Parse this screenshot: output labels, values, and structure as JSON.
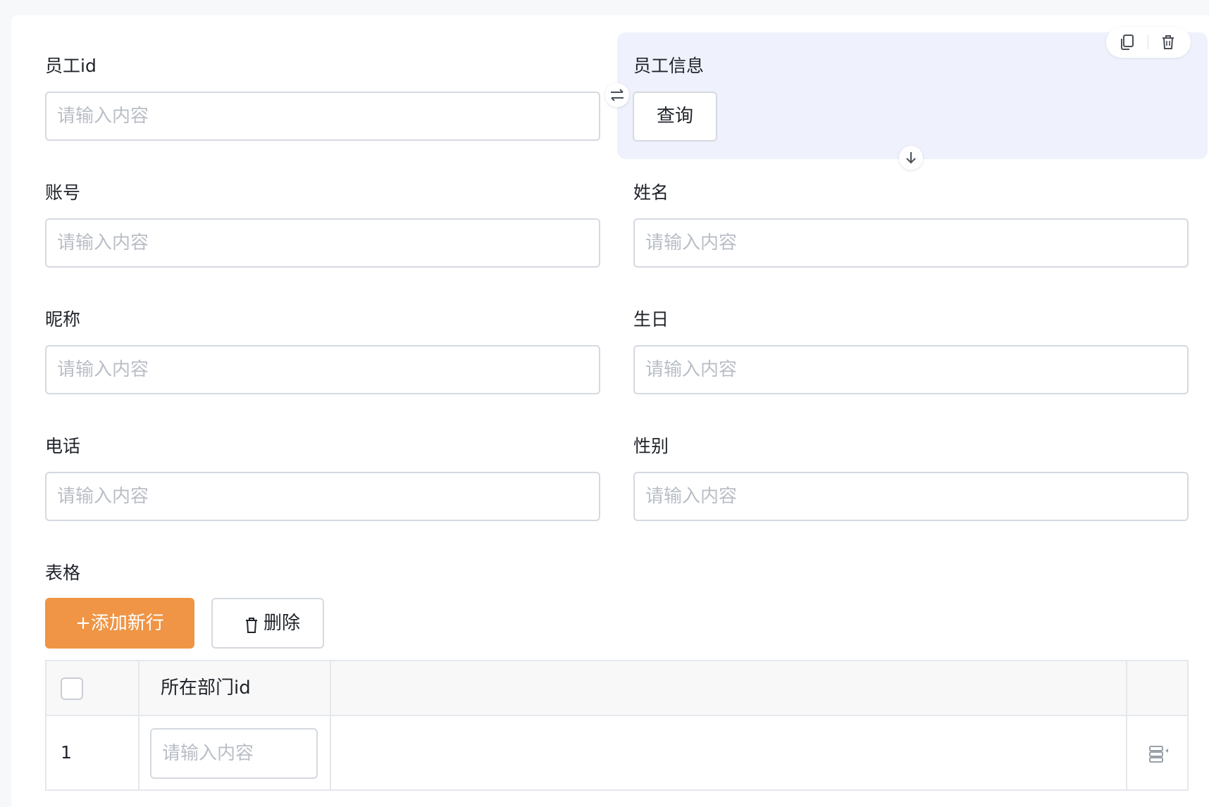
{
  "form": {
    "placeholder": "请输入内容",
    "fields": {
      "employee_id": "员工id",
      "account": "账号",
      "nickname": "昵称",
      "phone": "电话",
      "name": "姓名",
      "birthday": "生日",
      "gender": "性别"
    },
    "employee_info": {
      "label": "员工信息",
      "query_button": "查询"
    },
    "table_label": "表格"
  },
  "table": {
    "add_row_button": "+添加新行",
    "delete_button": "删除",
    "columns": [
      "所在部门id"
    ],
    "rows": [
      {
        "index": "1"
      }
    ]
  },
  "icons": {
    "copy": "copy-icon",
    "delete": "trash-icon",
    "swap": "swap-icon",
    "move_down": "arrow-down-icon",
    "row_action": "row-action-icon"
  },
  "colors": {
    "accent": "#ef9545",
    "selected_bg": "#eff2fc",
    "border": "#d5d9e0",
    "placeholder": "#b9bec6"
  }
}
